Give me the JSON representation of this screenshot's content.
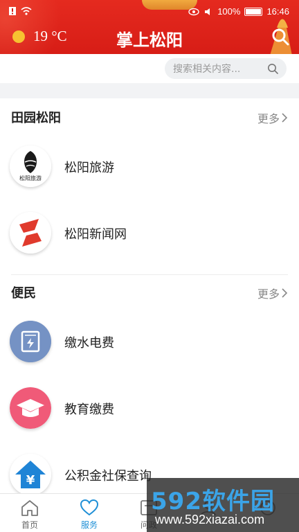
{
  "status_bar": {
    "battery": "100%",
    "time": "16:46"
  },
  "header": {
    "temperature": "19 °C",
    "title": "掌上松阳",
    "weather_icon": "sun-icon"
  },
  "search": {
    "placeholder": "搜索相关内容..."
  },
  "sections": [
    {
      "title": "田园松阳",
      "more": "更多",
      "items": [
        {
          "label": "松阳旅游",
          "icon": "songyang-tourism-logo"
        },
        {
          "label": "松阳新闻网",
          "icon": "songyang-news-logo"
        }
      ]
    },
    {
      "title": "便民",
      "more": "更多",
      "items": [
        {
          "label": "缴水电费",
          "icon": "utility-meter-icon",
          "color": "#6f8fc4"
        },
        {
          "label": "教育缴费",
          "icon": "graduation-cap-icon",
          "color": "#f05a78"
        },
        {
          "label": "公积金社保查询",
          "icon": "house-yuan-icon",
          "color": "#1f84d6"
        }
      ]
    }
  ],
  "logo_text": {
    "tourism": "松阳旅游"
  },
  "bottom_nav": [
    {
      "label": "首页",
      "icon": "home-icon",
      "active": false
    },
    {
      "label": "服务",
      "icon": "heart-icon",
      "active": true
    },
    {
      "label": "问政",
      "icon": "question-icon",
      "active": false
    },
    {
      "label": "",
      "icon": "people-icon",
      "active": false
    },
    {
      "label": "",
      "icon": "user-icon",
      "active": false
    }
  ],
  "watermark": {
    "logo": "592软件园",
    "url": "www.592xiazai.com"
  },
  "colors": {
    "header_red": "#d71d16",
    "accent_blue": "#1f8fd6"
  }
}
